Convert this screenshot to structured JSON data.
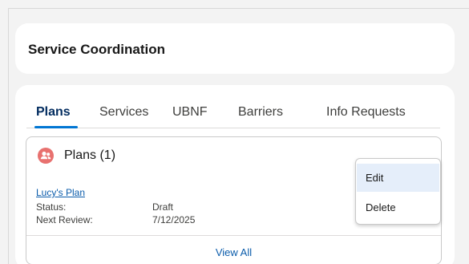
{
  "header": {
    "title": "Service Coordination"
  },
  "tabs": [
    {
      "label": "Plans",
      "active": true
    },
    {
      "label": "Services"
    },
    {
      "label": "UBNF"
    },
    {
      "label": "Barriers"
    },
    {
      "label": "Info Requests"
    }
  ],
  "plans_card": {
    "icon": "person-group-icon",
    "icon_color": "#e8716f",
    "title": "Plans (1)",
    "record": {
      "name": "Lucy's Plan",
      "fields": [
        {
          "label": "Status:",
          "value": "Draft"
        },
        {
          "label": "Next Review:",
          "value": "7/12/2025"
        }
      ]
    },
    "view_all": "View All"
  },
  "menu": {
    "items": [
      {
        "label": "Edit",
        "hover": true
      },
      {
        "label": "Delete"
      }
    ]
  },
  "colors": {
    "accent": "#0176d3",
    "link": "#0b5cab"
  }
}
